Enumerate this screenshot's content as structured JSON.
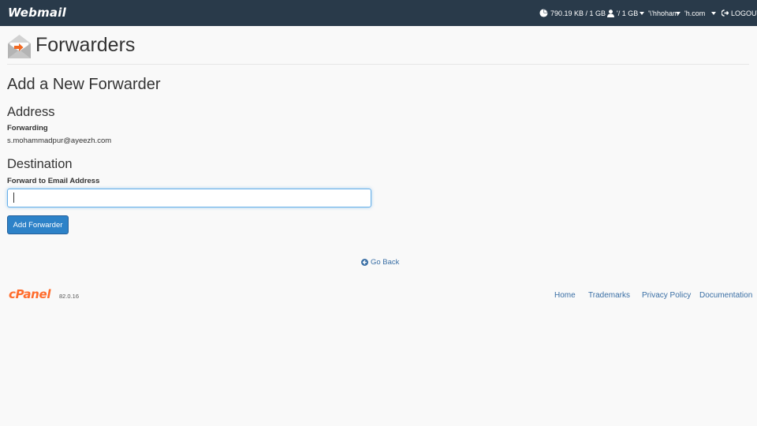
{
  "topbar": {
    "brand": "Webmail",
    "disk_usage": "790.19 KB / 1 GB",
    "quota": "​'/ 1 GB",
    "account_name": "'\\'hhoham",
    "domain": "'h.com",
    "logout": "LOGOUT"
  },
  "page": {
    "title": "Forwarders"
  },
  "form": {
    "heading": "Add a New Forwarder",
    "address_heading": "Address",
    "forwarding_label": "Forwarding",
    "forwarding_value": "s.mohammadpur@ayeezh.com",
    "destination_heading": "Destination",
    "forward_to_label": "Forward to Email Address",
    "forward_to_value": "",
    "submit_label": "Add Forwarder"
  },
  "go_back": "Go Back",
  "footer": {
    "logo": "cPanel",
    "version": "82.0.16",
    "links": [
      "Home",
      "Trademarks",
      "Privacy Policy",
      "Documentation"
    ]
  },
  "colors": {
    "topbar_bg": "#293a4a",
    "primary_button": "#2d82c8",
    "link": "#3a6fa5",
    "cpanel_orange": "#ff6c2c"
  }
}
